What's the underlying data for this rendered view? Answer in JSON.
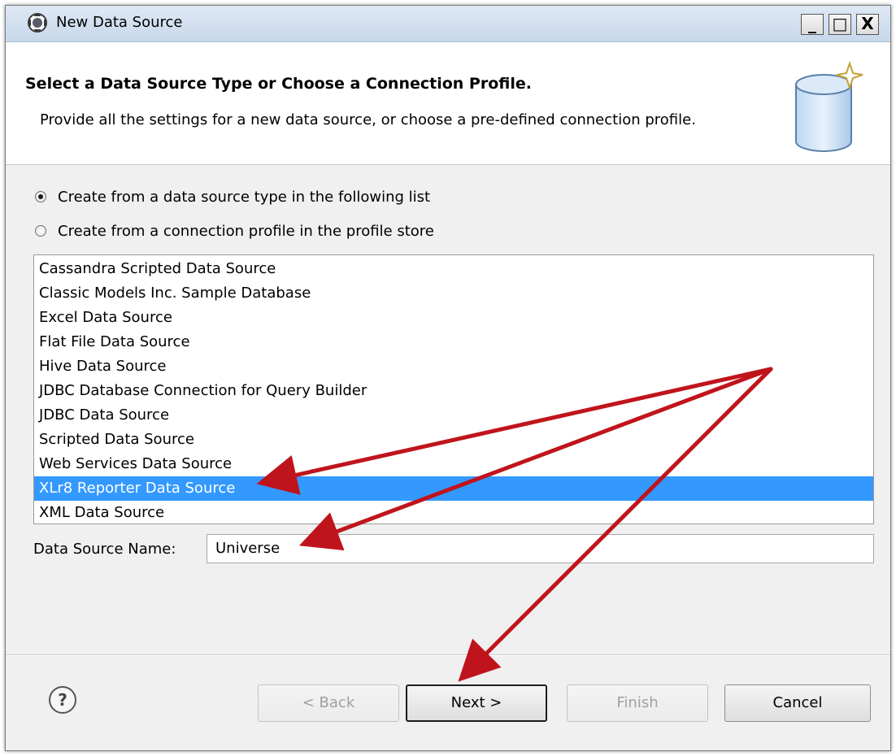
{
  "window": {
    "title": "New Data Source",
    "minimize": "_",
    "maximize": "□",
    "close": "X"
  },
  "header": {
    "title": "Select a Data Source Type or Choose a Connection Profile.",
    "description": "Provide all the settings for a new data source, or choose a pre-defined connection profile."
  },
  "options": {
    "create_from_type": "Create from a data source type in the following list",
    "create_from_profile": "Create from a connection profile in the profile store",
    "selected": "create_from_type"
  },
  "data_source_types": {
    "items": [
      "Cassandra Scripted Data Source",
      "Classic Models Inc. Sample Database",
      "Excel Data Source",
      "Flat File Data Source",
      "Hive Data Source",
      "JDBC Database Connection for Query Builder",
      "JDBC Data Source",
      "Scripted Data Source",
      "Web Services Data Source",
      "XLr8 Reporter Data Source",
      "XML Data Source"
    ],
    "selected": "XLr8 Reporter Data Source"
  },
  "name_field": {
    "label": "Data Source Name:",
    "value": "Universe"
  },
  "buttons": {
    "back": "< Back",
    "next": "Next >",
    "finish": "Finish",
    "cancel": "Cancel"
  },
  "colors": {
    "selection": "#3399ff",
    "annotation_arrow": "#c0141c"
  }
}
